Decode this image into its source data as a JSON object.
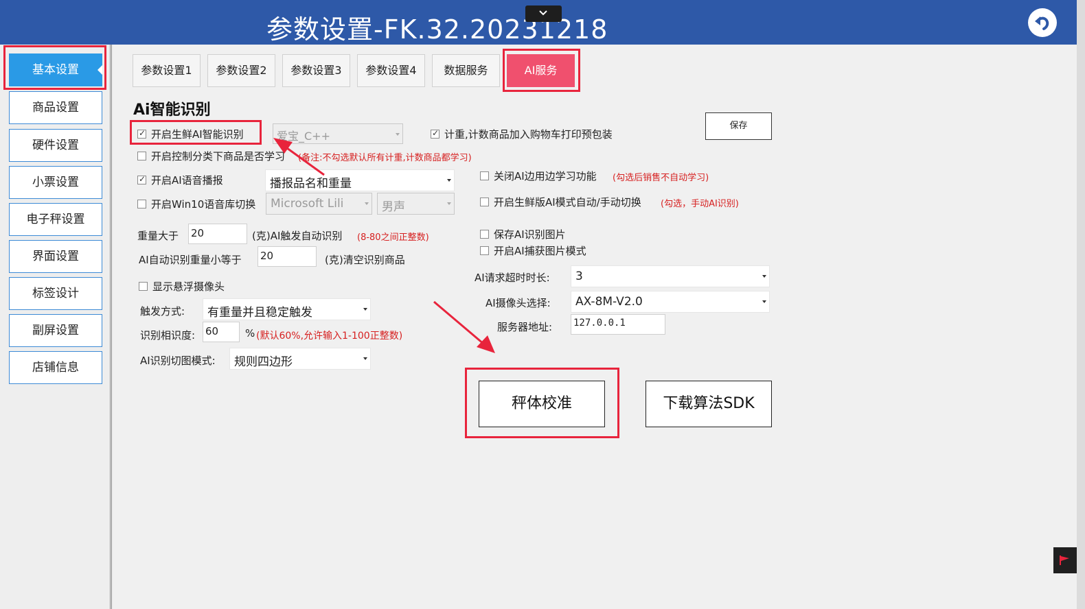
{
  "window": {
    "title": "参数设置-FK.32.20231218"
  },
  "sidebar": {
    "items": [
      "基本设置",
      "商品设置",
      "硬件设置",
      "小票设置",
      "电子秤设置",
      "界面设置",
      "标签设计",
      "副屏设置",
      "店铺信息"
    ]
  },
  "tabs": [
    "参数设置1",
    "参数设置2",
    "参数设置3",
    "参数设置4",
    "数据服务",
    "AI服务"
  ],
  "section": {
    "title": "Ai智能识别"
  },
  "left": {
    "fresh_ai": {
      "label": "开启生鲜AI智能识别",
      "checked": true,
      "engine": "爱宝_C++"
    },
    "category_learn": {
      "label": "开启控制分类下商品是否学习",
      "note": "(备注:不勾选默认所有计重,计数商品都学习)",
      "checked": false
    },
    "voice": {
      "label": "开启AI语音播报",
      "checked": true,
      "option": "播报品名和重量"
    },
    "win10": {
      "label": "开启Win10语音库切换",
      "checked": false,
      "voice": "Microsoft Lili",
      "gender": "男声"
    },
    "weight_gt": {
      "label": "重量大于",
      "value": "20",
      "suffix": "(克)AI触发自动识别",
      "note": "(8-80之间正整数)"
    },
    "weight_le": {
      "label": "AI自动识别重量小等于",
      "value": "20",
      "suffix": "(克)清空识别商品"
    },
    "float_cam": {
      "label": "显示悬浮摄像头",
      "checked": false
    },
    "trigger": {
      "label": "触发方式:",
      "value": "有重量并且稳定触发"
    },
    "similarity": {
      "label": "识别相识度:",
      "value": "60",
      "unit": "%",
      "note": "(默认60%,允许输入1-100正整数)"
    },
    "crop": {
      "label": "AI识别切图模式:",
      "value": "规则四边形"
    }
  },
  "right": {
    "count_pack": {
      "label": "计重,计数商品加入购物车打印预包装",
      "checked": true
    },
    "save_button": "保存",
    "close_learn": {
      "label": "关闭AI边用边学习功能",
      "note": "(勾选后销售不自动学习)",
      "checked": false
    },
    "auto_switch": {
      "label": "开启生鲜版AI模式自动/手动切换",
      "note": "(勾选，手动AI识别)",
      "checked": false
    },
    "save_img": {
      "label": "保存AI识别图片",
      "checked": false
    },
    "capture_mode": {
      "label": "开启AI捕获图片模式",
      "checked": false
    },
    "timeout": {
      "label": "AI请求超时时长:",
      "value": "3"
    },
    "camera": {
      "label": "AI摄像头选择:",
      "value": "AX-8M-V2.0"
    },
    "server": {
      "label": "服务器地址:",
      "value": "127.0.0.1"
    }
  },
  "buttons": {
    "calibrate": "秤体校准",
    "download_sdk": "下载算法SDK"
  },
  "colors": {
    "titlebar": "#2e59a8",
    "sidebar_active": "#2a9ae6",
    "tab_active": "#f0506e",
    "highlight": "#e8243c",
    "note": "#d61f1f"
  }
}
